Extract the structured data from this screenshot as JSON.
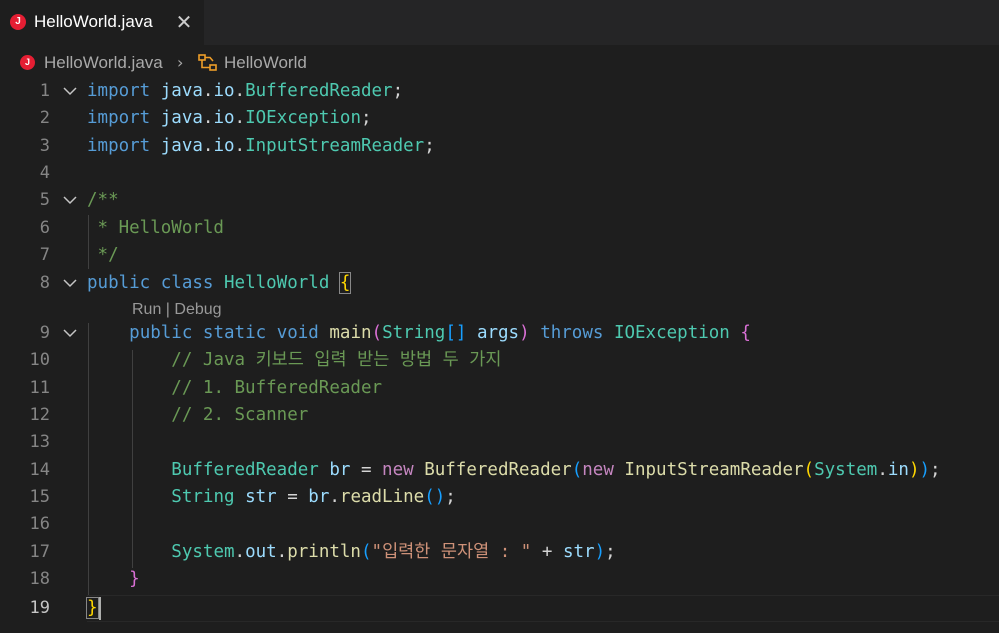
{
  "tab": {
    "icon_letter": "J",
    "label": "HelloWorld.java",
    "close_glyph": "✕"
  },
  "breadcrumb": {
    "icon_letter": "J",
    "file": "HelloWorld.java",
    "separator": "›",
    "class_name": "HelloWorld"
  },
  "codelens": "Run | Debug",
  "colors": {
    "background": "#1e1e1e",
    "keyword": "#569cd6",
    "type": "#4ec9b0",
    "comment": "#6a9955",
    "string": "#ce9178",
    "function": "#dcdcaa"
  },
  "active_line": 19,
  "lines": [
    {
      "n": "1",
      "folded": true,
      "tokens": [
        [
          "kw",
          "import"
        ],
        [
          "pu",
          " "
        ],
        [
          "pk",
          "java"
        ],
        [
          "pu",
          "."
        ],
        [
          "pk",
          "io"
        ],
        [
          "pu",
          "."
        ],
        [
          "ty",
          "BufferedReader"
        ],
        [
          "pu",
          ";"
        ]
      ]
    },
    {
      "n": "2",
      "tokens": [
        [
          "kw",
          "import"
        ],
        [
          "pu",
          " "
        ],
        [
          "pk",
          "java"
        ],
        [
          "pu",
          "."
        ],
        [
          "pk",
          "io"
        ],
        [
          "pu",
          "."
        ],
        [
          "ty",
          "IOException"
        ],
        [
          "pu",
          ";"
        ]
      ]
    },
    {
      "n": "3",
      "tokens": [
        [
          "kw",
          "import"
        ],
        [
          "pu",
          " "
        ],
        [
          "pk",
          "java"
        ],
        [
          "pu",
          "."
        ],
        [
          "pk",
          "io"
        ],
        [
          "pu",
          "."
        ],
        [
          "ty",
          "InputStreamReader"
        ],
        [
          "pu",
          ";"
        ]
      ]
    },
    {
      "n": "4",
      "tokens": []
    },
    {
      "n": "5",
      "folded": true,
      "tokens": [
        [
          "cm",
          "/**"
        ]
      ]
    },
    {
      "n": "6",
      "tokens": [
        [
          "cm",
          " * HelloWorld"
        ]
      ]
    },
    {
      "n": "7",
      "tokens": [
        [
          "cm",
          " */"
        ]
      ]
    },
    {
      "n": "8",
      "folded": true,
      "tokens": [
        [
          "kw",
          "public"
        ],
        [
          "pu",
          " "
        ],
        [
          "kw",
          "class"
        ],
        [
          "pu",
          " "
        ],
        [
          "ty",
          "HelloWorld"
        ],
        [
          "pu",
          " "
        ],
        [
          "b1 bm",
          "{"
        ]
      ]
    },
    {
      "n": "9",
      "folded": true,
      "tokens": [
        [
          "pu",
          "    "
        ],
        [
          "kw",
          "public"
        ],
        [
          "pu",
          " "
        ],
        [
          "kw",
          "static"
        ],
        [
          "pu",
          " "
        ],
        [
          "kw",
          "void"
        ],
        [
          "pu",
          " "
        ],
        [
          "fn",
          "main"
        ],
        [
          "b2",
          "("
        ],
        [
          "ty",
          "String"
        ],
        [
          "b3",
          "[]"
        ],
        [
          "pu",
          " "
        ],
        [
          "va",
          "args"
        ],
        [
          "b2",
          ")"
        ],
        [
          "pu",
          " "
        ],
        [
          "kw",
          "throws"
        ],
        [
          "pu",
          " "
        ],
        [
          "ty",
          "IOException"
        ],
        [
          "pu",
          " "
        ],
        [
          "b2",
          "{"
        ]
      ]
    },
    {
      "n": "10",
      "tokens": [
        [
          "pu",
          "        "
        ],
        [
          "cm",
          "// Java 키보드 입력 받는 방법 두 가지"
        ]
      ]
    },
    {
      "n": "11",
      "tokens": [
        [
          "pu",
          "        "
        ],
        [
          "cm",
          "// 1. BufferedReader"
        ]
      ]
    },
    {
      "n": "12",
      "tokens": [
        [
          "pu",
          "        "
        ],
        [
          "cm",
          "// 2. Scanner"
        ]
      ]
    },
    {
      "n": "13",
      "tokens": []
    },
    {
      "n": "14",
      "tokens": [
        [
          "pu",
          "        "
        ],
        [
          "ty",
          "BufferedReader"
        ],
        [
          "pu",
          " "
        ],
        [
          "va",
          "br"
        ],
        [
          "pu",
          " = "
        ],
        [
          "kw2",
          "new"
        ],
        [
          "pu",
          " "
        ],
        [
          "fn",
          "BufferedReader"
        ],
        [
          "b3",
          "("
        ],
        [
          "kw2",
          "new"
        ],
        [
          "pu",
          " "
        ],
        [
          "fn",
          "InputStreamReader"
        ],
        [
          "b1",
          "("
        ],
        [
          "ty",
          "System"
        ],
        [
          "pu",
          "."
        ],
        [
          "va",
          "in"
        ],
        [
          "b1",
          ")"
        ],
        [
          "b3",
          ")"
        ],
        [
          "pu",
          ";"
        ]
      ]
    },
    {
      "n": "15",
      "tokens": [
        [
          "pu",
          "        "
        ],
        [
          "ty",
          "String"
        ],
        [
          "pu",
          " "
        ],
        [
          "va",
          "str"
        ],
        [
          "pu",
          " = "
        ],
        [
          "va",
          "br"
        ],
        [
          "pu",
          "."
        ],
        [
          "fn",
          "readLine"
        ],
        [
          "b3",
          "()"
        ],
        [
          "pu",
          ";"
        ]
      ]
    },
    {
      "n": "16",
      "tokens": []
    },
    {
      "n": "17",
      "tokens": [
        [
          "pu",
          "        "
        ],
        [
          "ty",
          "System"
        ],
        [
          "pu",
          "."
        ],
        [
          "va",
          "out"
        ],
        [
          "pu",
          "."
        ],
        [
          "fn",
          "println"
        ],
        [
          "b3",
          "("
        ],
        [
          "st",
          "\"입력한 문자열 : \""
        ],
        [
          "pu",
          " + "
        ],
        [
          "va",
          "str"
        ],
        [
          "b3",
          ")"
        ],
        [
          "pu",
          ";"
        ]
      ]
    },
    {
      "n": "18",
      "tokens": [
        [
          "pu",
          "    "
        ],
        [
          "b2",
          "}"
        ]
      ]
    },
    {
      "n": "19",
      "tokens": [
        [
          "b1 bm",
          "}"
        ]
      ]
    }
  ]
}
